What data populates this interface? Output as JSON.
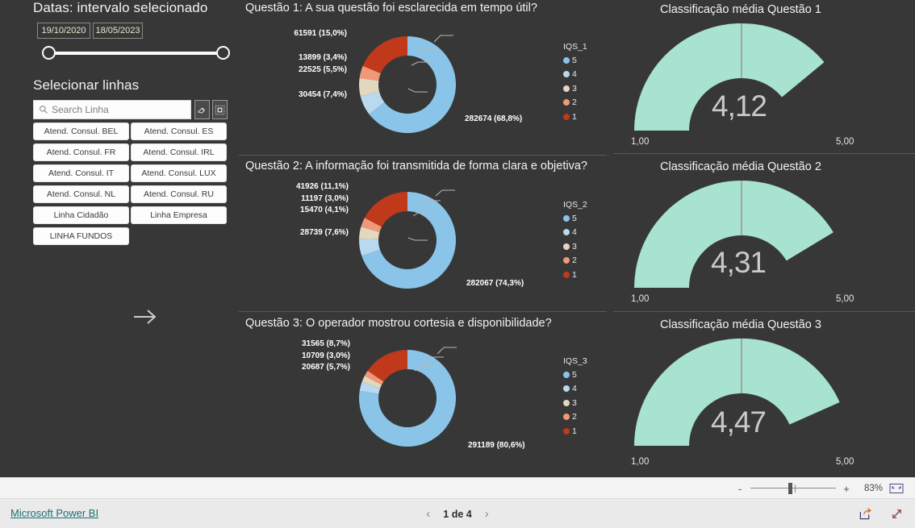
{
  "theme": {
    "canvas_bg": "#373737",
    "text": "#f2f2f2",
    "gauge_fill": "#a8e2d0",
    "brand_link": "#1c6e76",
    "slice_colors": [
      "#8ac4e8",
      "#b9d9ef",
      "#e3d8bd",
      "#f09878",
      "#c0391b"
    ]
  },
  "left_panel": {
    "dates_title": "Datas: intervalo selecionado",
    "date_from": "19/10/2020",
    "date_to": "18/05/2023",
    "lines_title": "Selecionar linhas",
    "search_placeholder": "Search Linha",
    "search_value": "",
    "search_icon": "search-icon",
    "clear_icon": "eraser-icon",
    "focus_icon": "focus-mode-icon",
    "next_icon": "arrow-right-icon",
    "line_buttons": [
      "Atend. Consul. BEL",
      "Atend. Consul. ES",
      "Atend. Consul. FR",
      "Atend. Consul. IRL",
      "Atend. Consul. IT",
      "Atend. Consul. LUX",
      "Atend. Consul. NL",
      "Atend. Consul. RU",
      "Linha Cidadão",
      "Linha Empresa",
      "LINHA FUNDOS"
    ]
  },
  "chart_data": [
    {
      "type": "pie",
      "title": "Questão 1: A sua questão foi esclarecida em tempo útil?",
      "legend_title": "IQS_1",
      "legend_position": "right",
      "categories": [
        "5",
        "4",
        "3",
        "2",
        "1"
      ],
      "values": [
        282674,
        30454,
        22525,
        13899,
        61591
      ],
      "labels": [
        "282674 (68,8%)",
        "30454 (7,4%)",
        "22525 (5,5%)",
        "13899 (3,4%)",
        "61591 (15,0%)"
      ],
      "percents": [
        68.8,
        7.4,
        5.5,
        3.4,
        15.0
      ]
    },
    {
      "type": "pie",
      "title": "Questão 2: A informação foi transmitida de forma clara e objetiva?",
      "legend_title": "IQS_2",
      "legend_position": "right",
      "categories": [
        "5",
        "4",
        "3",
        "2",
        "1"
      ],
      "values": [
        282067,
        28739,
        15470,
        11197,
        41926
      ],
      "labels": [
        "282067 (74,3%)",
        "28739 (7,6%)",
        "15470 (4,1%)",
        "11197 (3,0%)",
        "41926 (11,1%)"
      ],
      "percents": [
        74.3,
        7.6,
        4.1,
        3.0,
        11.1
      ]
    },
    {
      "type": "pie",
      "title": "Questão 3: O operador mostrou cortesia e disponibilidade?",
      "legend_title": "IQS_3",
      "legend_position": "right",
      "categories": [
        "5",
        "4",
        "3",
        "2",
        "1"
      ],
      "values": [
        291189,
        20687,
        10709,
        31565
      ],
      "labels": [
        "291189 (80,6%)",
        "20687 (5,7%)",
        "10709 (3,0%)",
        "31565 (8,7%)"
      ],
      "percents": [
        80.6,
        5.7,
        3.0,
        2.0,
        8.7
      ]
    },
    {
      "type": "gauge",
      "title": "Classificação média Questão 1",
      "value": "4,12",
      "value_num": 4.12,
      "min_label": "1,00",
      "max_label": "5,00",
      "range": [
        1,
        5
      ],
      "target": 3.0
    },
    {
      "type": "gauge",
      "title": "Classificação média Questão 2",
      "value": "4,31",
      "value_num": 4.31,
      "min_label": "1,00",
      "max_label": "5,00",
      "range": [
        1,
        5
      ],
      "target": 3.0
    },
    {
      "type": "gauge",
      "title": "Classificação média Questão 3",
      "value": "4,47",
      "value_num": 4.47,
      "min_label": "1,00",
      "max_label": "5,00",
      "range": [
        1,
        5
      ],
      "target": 3.0
    }
  ],
  "status_bar": {
    "zoom_out": "-",
    "zoom_in": "+",
    "zoom_level": "83%",
    "fit_icon": "fit-to-page-icon"
  },
  "footer": {
    "brand": "Microsoft Power BI",
    "prev_icon": "chevron-left-icon",
    "page_label": "1 de 4",
    "next_icon": "chevron-right-icon",
    "share_icon": "share-icon",
    "fullscreen_icon": "fullscreen-icon"
  }
}
